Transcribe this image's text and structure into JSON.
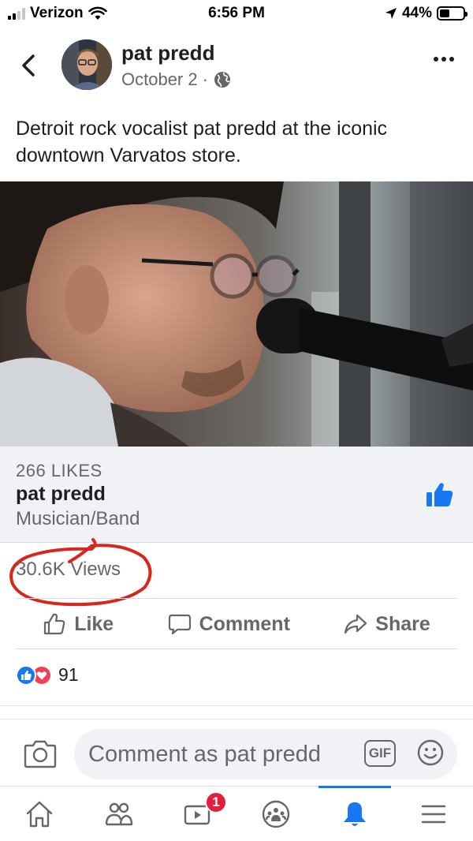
{
  "status_bar": {
    "carrier": "Verizon",
    "time": "6:56 PM",
    "battery_percent": "44%",
    "battery_level": 0.44
  },
  "post": {
    "author": "pat predd",
    "date": "October 2",
    "separator": "·",
    "text": "Detroit rock vocalist pat predd at the iconic downtown Varvatos store."
  },
  "page_card": {
    "likes": "266 LIKES",
    "name": "pat predd",
    "category": "Musician/Band"
  },
  "views": "30.6K Views",
  "actions": {
    "like": "Like",
    "comment": "Comment",
    "share": "Share"
  },
  "reactions": {
    "count": "91",
    "types": [
      "like",
      "love"
    ]
  },
  "composer": {
    "placeholder": "Comment as pat predd",
    "gif_label": "GIF"
  },
  "tab_bar": {
    "items": [
      "home-icon",
      "friends-icon",
      "watch-icon",
      "groups-icon",
      "notifications-icon",
      "menu-icon"
    ],
    "watch_badge": "1",
    "active": "notifications-icon"
  },
  "colors": {
    "accent": "#1877f2",
    "badge": "#e41e3f",
    "annotation": "#d9261c"
  }
}
